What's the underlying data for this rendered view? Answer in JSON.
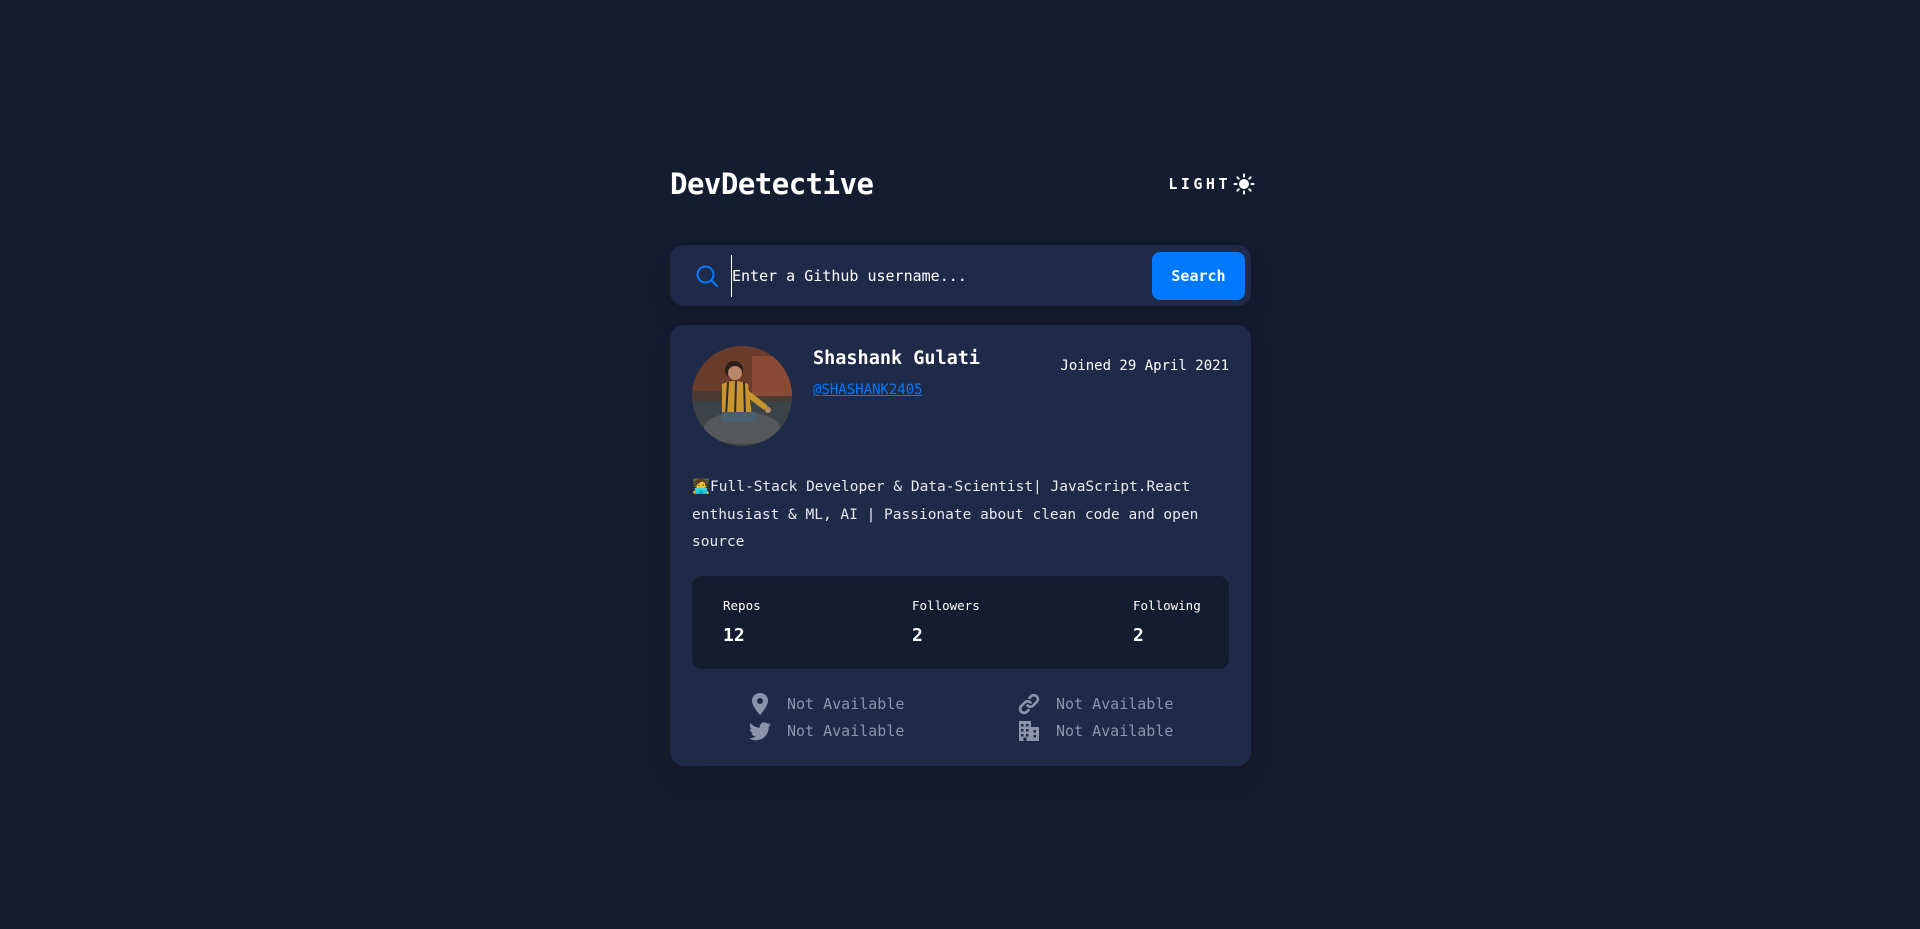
{
  "header": {
    "brand": "DevDetective",
    "mode_label": "LIGHT"
  },
  "search": {
    "placeholder": "Enter a Github username...",
    "button_label": "Search"
  },
  "profile": {
    "name": "Shashank Gulati",
    "login": "@SHASHANK2405",
    "joined": "Joined 29 April 2021",
    "bio": "🧑‍💻Full-Stack Developer & Data-Scientist| JavaScript.React enthusiast & ML, AI | Passionate about clean code and open source",
    "stats": {
      "repos_label": "Repos",
      "repos": "12",
      "followers_label": "Followers",
      "followers": "2",
      "following_label": "Following",
      "following": "2"
    },
    "links": {
      "location": "Not Available",
      "blog": "Not Available",
      "twitter": "Not Available",
      "company": "Not Available"
    }
  },
  "colors": {
    "background": "#141c2f",
    "card": "#1f2a48",
    "accent": "#0079ff",
    "muted": "#8c94ac"
  },
  "icons": [
    "sun-icon",
    "search-icon",
    "location-icon",
    "link-icon",
    "twitter-icon",
    "building-icon"
  ]
}
